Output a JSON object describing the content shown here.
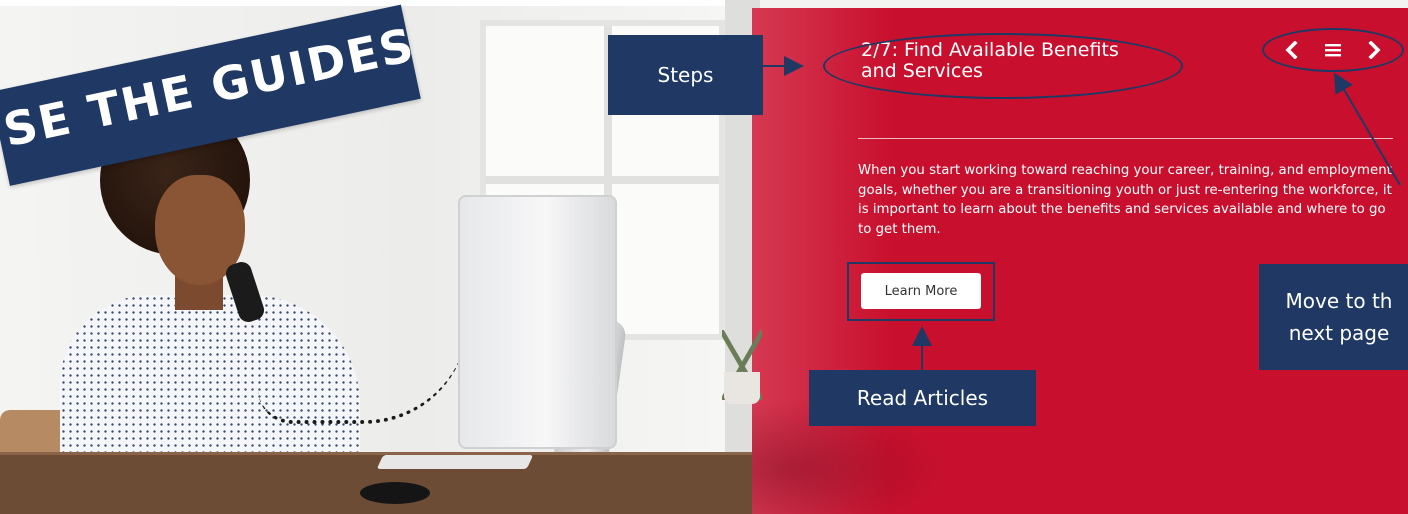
{
  "banner": {
    "text": "SE THE GUIDES"
  },
  "step": {
    "title_line1": "2/7: Find Available Benefits",
    "title_line2": "and Services",
    "description": "When you start working toward reaching your career, training, and employment goals, whether you are a transitioning youth or just re-entering the workforce, it is important to learn about the benefits and services available and where to go to get them.",
    "learn_more_label": "Learn More"
  },
  "nav": {
    "prev_icon": "chevron-left-icon",
    "menu_icon": "hamburger-menu-icon",
    "next_icon": "chevron-right-icon"
  },
  "callouts": {
    "steps": "Steps",
    "read_articles": "Read Articles",
    "move_line1": "Move to th",
    "move_line2": "next page"
  },
  "colors": {
    "panel_red": "#c8102e",
    "navy": "#1f3864",
    "white": "#ffffff"
  }
}
